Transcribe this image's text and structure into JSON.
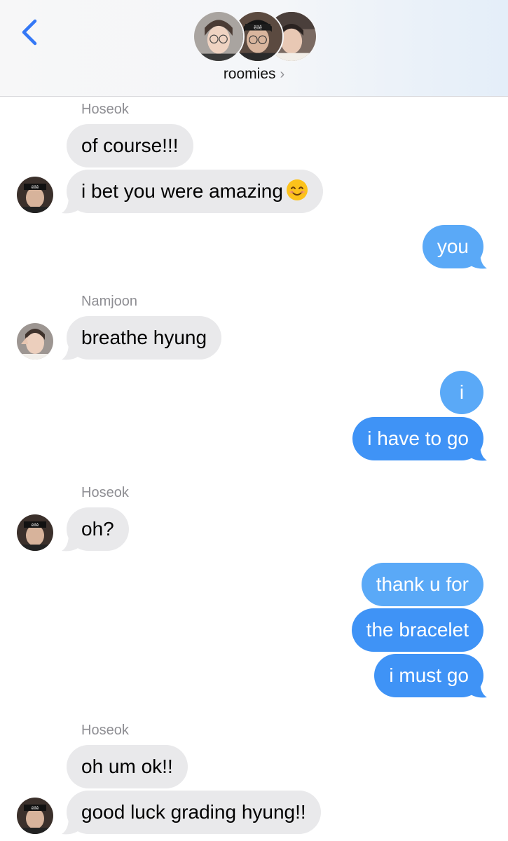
{
  "header": {
    "title": "roomies",
    "chevron": "›",
    "back_icon": "chevron-left-icon",
    "accent_color": "#3478f6"
  },
  "colors": {
    "incoming_bubble": "#e9e9eb",
    "outgoing_bubble": "#3f93f6",
    "sender_label": "#8e8e93"
  },
  "messages": [
    {
      "sender": "Hoseok"
    },
    {
      "text": "of course!!!"
    },
    {
      "text": "i bet you were amazing",
      "emoji": "smiling-face-icon"
    },
    {
      "text": "you"
    },
    {
      "sender": "Namjoon"
    },
    {
      "text": "breathe hyung"
    },
    {
      "text": "i"
    },
    {
      "text": "i have to go"
    },
    {
      "sender": "Hoseok"
    },
    {
      "text": "oh?"
    },
    {
      "text": "thank u for"
    },
    {
      "text": "the bracelet"
    },
    {
      "text": "i must go"
    },
    {
      "sender": "Hoseok"
    },
    {
      "text": "oh um ok!!"
    },
    {
      "text": "good luck grading hyung!!"
    }
  ]
}
